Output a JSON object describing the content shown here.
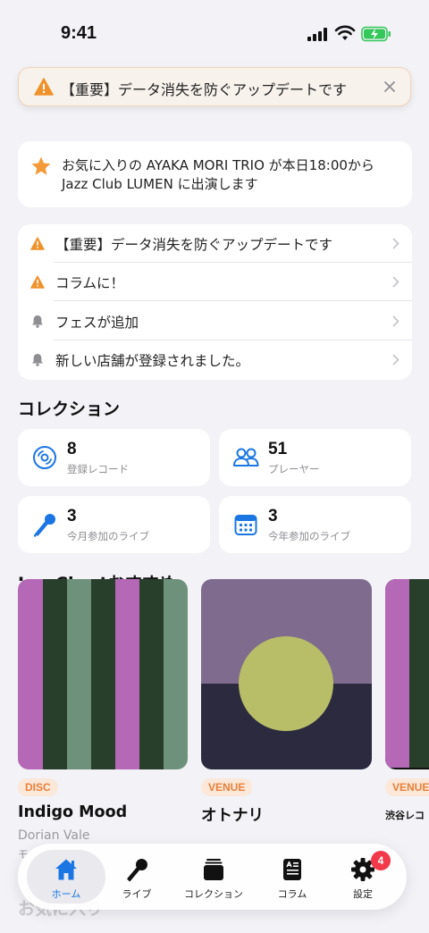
{
  "status": {
    "time": "9:41"
  },
  "banner": {
    "text": "【重要】データ消失を防ぐアップデートです"
  },
  "favorite": {
    "text": "お気に入りの AYAKA MORI TRIO が本日18:00から Jazz Club LUMEN に出演します"
  },
  "notifications": [
    {
      "text": "【重要】データ消失を防ぐアップデートです",
      "icon": "warning-icon"
    },
    {
      "text": "コラムに！",
      "icon": "warning-icon"
    },
    {
      "text": "フェスが追加",
      "icon": "bell-icon"
    },
    {
      "text": "新しい店舗が登録されました。",
      "icon": "bell-icon"
    }
  ],
  "collection": {
    "title": "コレクション",
    "stats": [
      {
        "value": "8",
        "label": "登録レコード",
        "icon": "disc-icon"
      },
      {
        "value": "51",
        "label": "プレーヤー",
        "icon": "people-icon"
      },
      {
        "value": "3",
        "label": "今月参加のライブ",
        "icon": "microphone-icon"
      },
      {
        "value": "3",
        "label": "今年参加のライブ",
        "icon": "calendar-icon"
      }
    ]
  },
  "recommend": {
    "title": "JazzChartおすすめ",
    "items": [
      {
        "badge": "DISC",
        "title": "Indigo Mood",
        "subtitle": "Dorian Vale",
        "extra": "モ"
      },
      {
        "badge": "VENUE",
        "title": "オトナリ",
        "subtitle": ""
      },
      {
        "badge": "VENUE",
        "title": "渋谷レコ",
        "subtitle": ""
      }
    ]
  },
  "next_section": {
    "title": "お気に入り"
  },
  "tabbar": {
    "tabs": [
      {
        "label": "ホーム",
        "icon": "home-icon",
        "active": true
      },
      {
        "label": "ライブ",
        "icon": "microphone-icon"
      },
      {
        "label": "コレクション",
        "icon": "collection-icon"
      },
      {
        "label": "コラム",
        "icon": "column-icon"
      },
      {
        "label": "設定",
        "icon": "gear-icon",
        "badge": "4"
      }
    ]
  },
  "colors": {
    "accent": "#1b76e3",
    "warning": "#f0922b",
    "badge_red": "#f2394a",
    "star": "#f29b38"
  }
}
